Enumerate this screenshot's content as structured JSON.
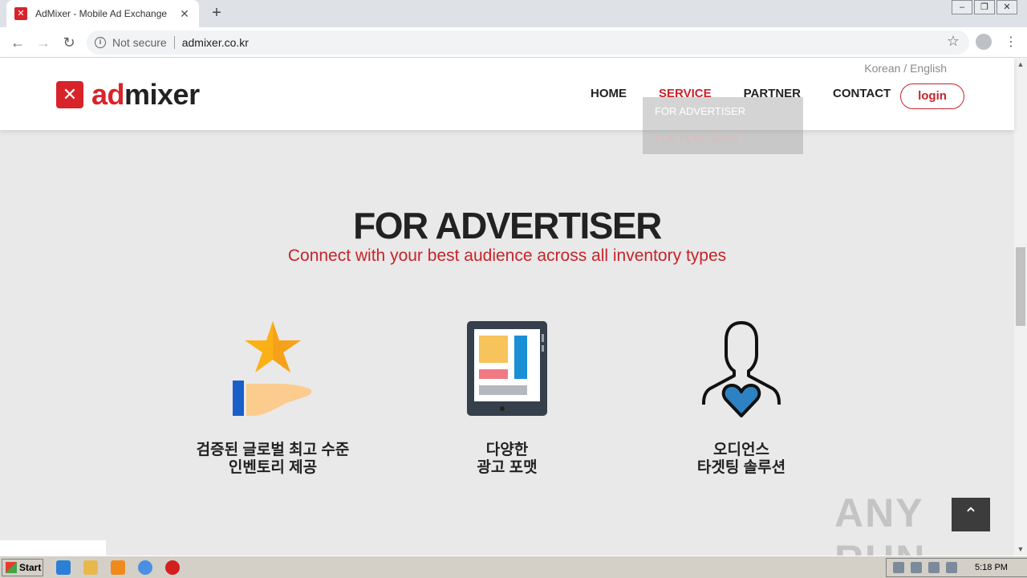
{
  "browser": {
    "tab_title": "AdMixer - Mobile Ad Exchange",
    "tab_favicon": "admixer-favicon",
    "security_label": "Not secure",
    "url": "admixer.co.kr"
  },
  "site": {
    "logo": {
      "ad": "ad",
      "mixer": "mixer"
    },
    "lang_switch": "Korean / English",
    "nav": [
      {
        "label": "HOME",
        "active": false
      },
      {
        "label": "SERVICE",
        "active": true
      },
      {
        "label": "PARTNER",
        "active": false
      },
      {
        "label": "CONTACT",
        "active": false
      }
    ],
    "login_label": "login",
    "dropdown": [
      {
        "label": "FOR ADVERTISER"
      },
      {
        "label": "FOR PUBLISHER"
      }
    ],
    "brand_color": "#d8232a"
  },
  "main": {
    "title": "FOR ADVERTISER",
    "subtitle": "Connect with your best audience across all inventory types",
    "features": [
      {
        "icon": "star-hand-icon",
        "line1": "검증된 글로벌 최고 수준",
        "line2": "인벤토리 제공"
      },
      {
        "icon": "tablet-ad-icon",
        "line1": "다양한",
        "line2": "광고 포맷"
      },
      {
        "icon": "person-heart-icon",
        "line1": "오디언스",
        "line2": "타겟팅 솔루션"
      }
    ],
    "watermark": "ANY RUN"
  },
  "taskbar": {
    "start_label": "Start",
    "clock": "5:18 PM"
  }
}
